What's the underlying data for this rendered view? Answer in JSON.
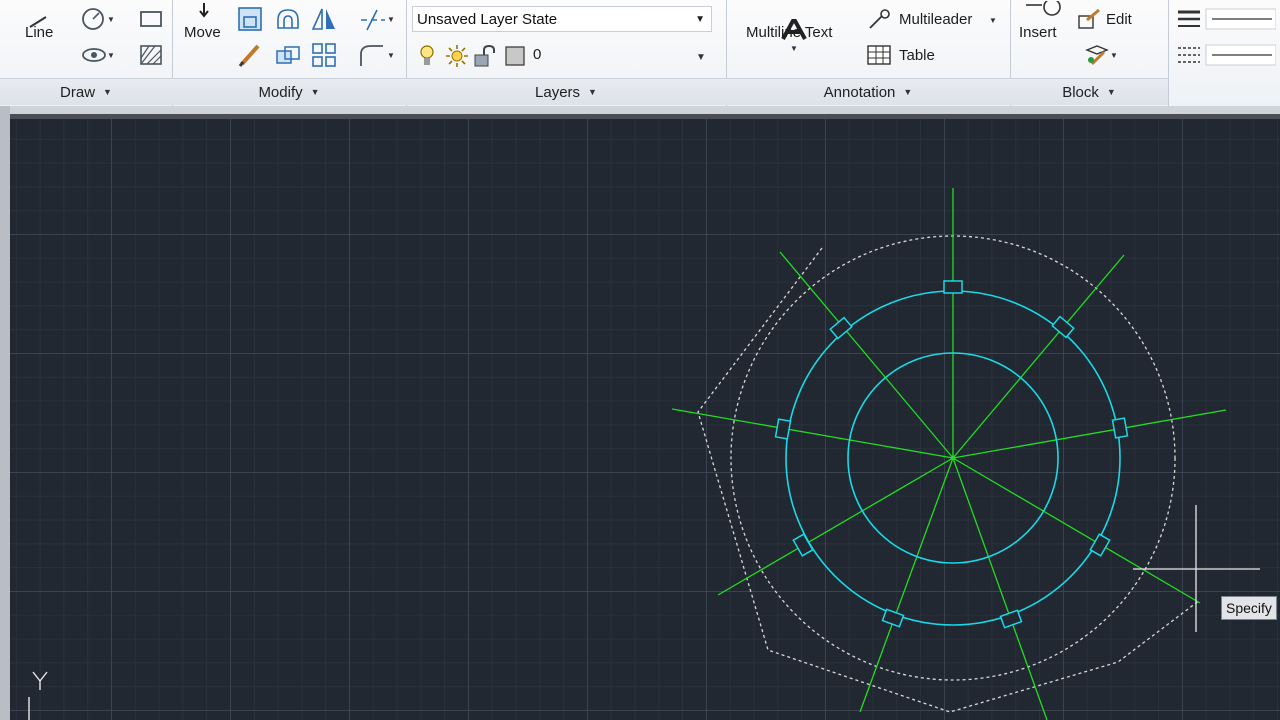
{
  "ribbon": {
    "draw": {
      "title": "Draw",
      "line_label": "Line"
    },
    "modify": {
      "title": "Modify",
      "move_label": "Move"
    },
    "layers": {
      "title": "Layers",
      "layer_state": "Unsaved Layer State",
      "current_layer": "0"
    },
    "annotation": {
      "title": "Annotation",
      "multiline_text_label": "Multiline Text",
      "multileader_label": "Multileader",
      "table_label": "Table"
    },
    "block": {
      "title": "Block",
      "insert_label": "Insert",
      "edit_label": "Edit"
    }
  },
  "canvas": {
    "tooltip": "Specify",
    "ucs_y_label": "Y",
    "colors": {
      "background": "#212831",
      "cyan": "#19d9e6",
      "green": "#22dd22",
      "preview": "#d9d9d9"
    }
  }
}
